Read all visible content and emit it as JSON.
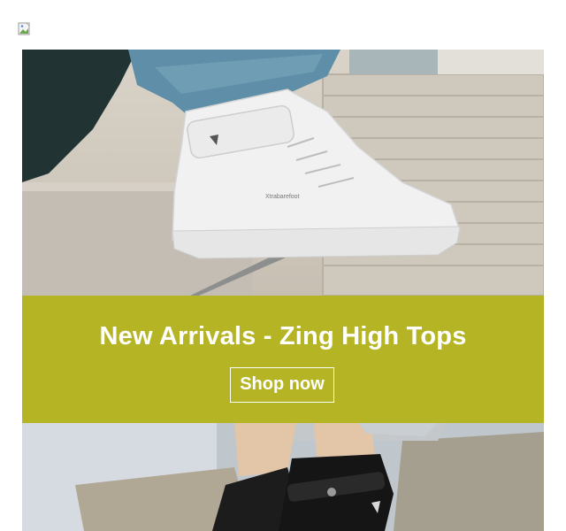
{
  "header": {
    "broken_image_icon": "broken-image-icon"
  },
  "banner": {
    "title": "New Arrivals - Zing High Tops",
    "cta_label": "Shop now",
    "background_color": "#b5b425"
  },
  "hero_top": {
    "sneaker_brand_text": "Xtrabarefoot"
  }
}
